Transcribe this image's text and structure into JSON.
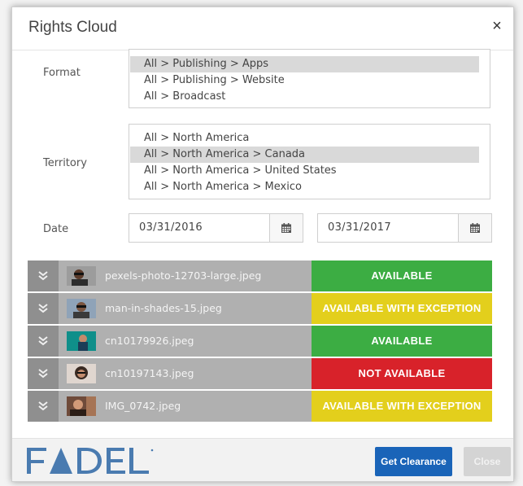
{
  "dialog": {
    "title": "Rights Cloud",
    "close_glyph": "×"
  },
  "format": {
    "label": "Format",
    "options": [
      {
        "text": "All > Publishing > Apps",
        "selected": true
      },
      {
        "text": "All > Publishing > Website",
        "selected": false
      },
      {
        "text": "All > Broadcast",
        "selected": false
      }
    ]
  },
  "territory": {
    "label": "Territory",
    "options": [
      {
        "text": "All > North America",
        "selected": false
      },
      {
        "text": "All > North America > Canada",
        "selected": true
      },
      {
        "text": "All > North America > United States",
        "selected": false
      },
      {
        "text": "All > North America > Mexico",
        "selected": false
      }
    ]
  },
  "date": {
    "label": "Date",
    "start": "03/31/2016",
    "end": "03/31/2017",
    "icon": "calendar-icon"
  },
  "files": [
    {
      "name": "pexels-photo-12703-large.jpeg",
      "status": "AVAILABLE",
      "status_color": "#3cad43"
    },
    {
      "name": "man-in-shades-15.jpeg",
      "status": "AVAILABLE WITH EXCEPTION",
      "status_color": "#e3cf1c"
    },
    {
      "name": "cn10179926.jpeg",
      "status": "AVAILABLE",
      "status_color": "#3cad43"
    },
    {
      "name": "cn10197143.jpeg",
      "status": "NOT AVAILABLE",
      "status_color": "#d8222a"
    },
    {
      "name": "IMG_0742.jpeg",
      "status": "AVAILABLE WITH EXCEPTION",
      "status_color": "#e3cf1c"
    }
  ],
  "footer": {
    "logo_text": "FADEL",
    "logo_color": "#4a7bb0",
    "primary_button": "Get Clearance",
    "close_button": "Close",
    "primary_color": "#1a64b8"
  }
}
